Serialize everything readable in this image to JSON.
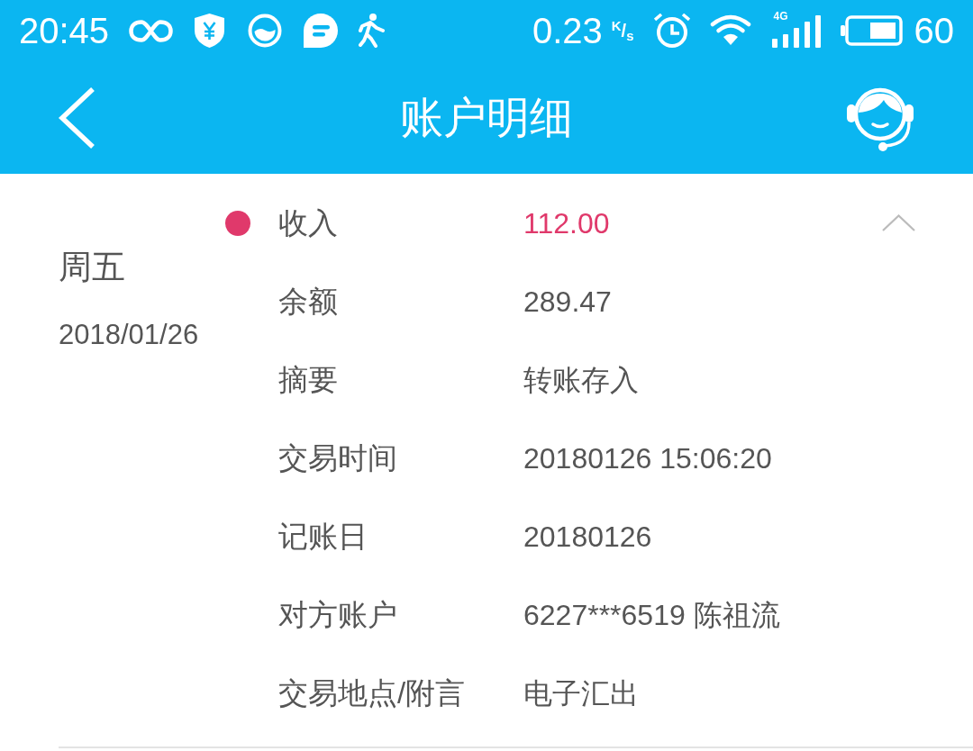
{
  "status_bar": {
    "time": "20:45",
    "speed": "0.23",
    "speed_unit": "$^{K}$/$_{s}$",
    "network": "4G",
    "battery": "60"
  },
  "header": {
    "title": "账户明细"
  },
  "transactions": [
    {
      "day": "周五",
      "date": "2018/01/26",
      "color": "#e0396b",
      "expanded": true,
      "fields": [
        {
          "kind": "amount",
          "label": "收入",
          "value": "112.00"
        },
        {
          "kind": "text",
          "label": "余额",
          "value": "289.47"
        },
        {
          "kind": "text",
          "label": "摘要",
          "value": "转账存入"
        },
        {
          "kind": "text",
          "label": "交易时间",
          "value": "20180126 15:06:20"
        },
        {
          "kind": "text",
          "label": "记账日",
          "value": "20180126"
        },
        {
          "kind": "text",
          "label": "对方账户",
          "value": "6227***6519 陈祖流"
        },
        {
          "kind": "text",
          "label": "交易地点/附言",
          "value": "电子汇出"
        }
      ]
    }
  ]
}
